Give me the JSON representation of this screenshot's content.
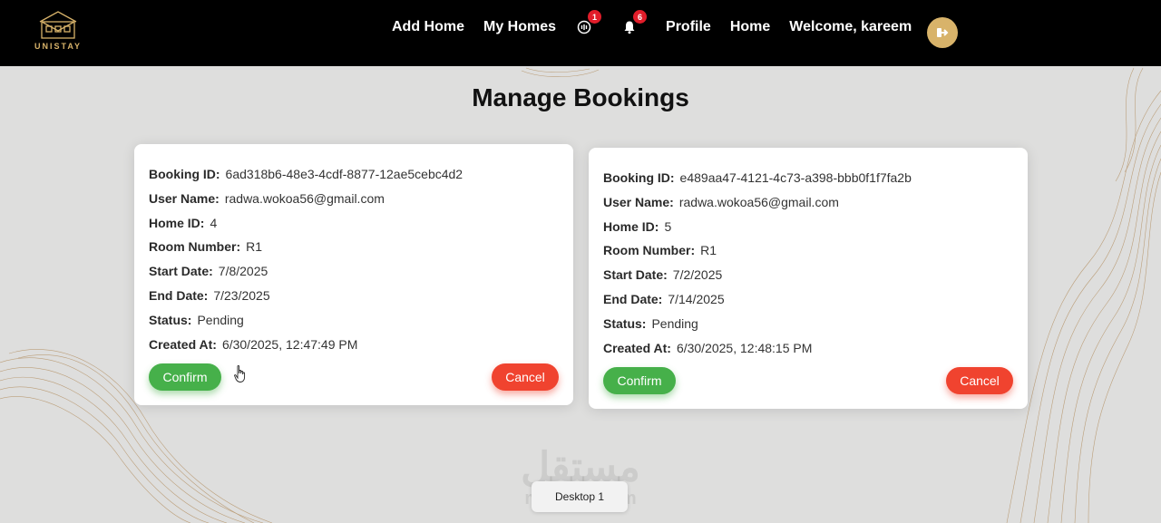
{
  "brand": {
    "name": "UNISTAY",
    "accent": "#d8b36a"
  },
  "nav": {
    "items": [
      {
        "label": "Add Home"
      },
      {
        "label": "My Homes"
      }
    ],
    "chat_badge": "1",
    "notifications_badge": "6",
    "items_after": [
      {
        "label": "Profile"
      },
      {
        "label": "Home"
      },
      {
        "label": "Welcome, kareem"
      }
    ],
    "logout_icon": "logout-icon"
  },
  "page": {
    "title": "Manage Bookings"
  },
  "labels": {
    "booking_id": "Booking ID:",
    "user_name": "User Name:",
    "home_id": "Home ID:",
    "room_number": "Room Number:",
    "start_date": "Start Date:",
    "end_date": "End Date:",
    "status": "Status:",
    "created_at": "Created At:",
    "confirm": "Confirm",
    "cancel": "Cancel"
  },
  "bookings": [
    {
      "booking_id": "6ad318b6-48e3-4cdf-8877-12ae5cebc4d2",
      "user_name": "radwa.wokoa56@gmail.com",
      "home_id": "4",
      "room_number": "R1",
      "start_date": "7/8/2025",
      "end_date": "7/23/2025",
      "status": "Pending",
      "created_at": "6/30/2025, 12:47:49 PM"
    },
    {
      "booking_id": "e489aa47-4121-4c73-a398-bbb0f1f7fa2b",
      "user_name": "radwa.wokoa56@gmail.com",
      "home_id": "5",
      "room_number": "R1",
      "start_date": "7/2/2025",
      "end_date": "7/14/2025",
      "status": "Pending",
      "created_at": "6/30/2025, 12:48:15 PM"
    }
  ],
  "overlay": {
    "watermark_ar": "مستقل",
    "watermark_lat": "mostaql.com",
    "taskbar_label": "Desktop 1"
  },
  "colors": {
    "confirm": "#46b04a",
    "cancel": "#f0432f",
    "navbar": "#000000",
    "background": "#dededd"
  }
}
